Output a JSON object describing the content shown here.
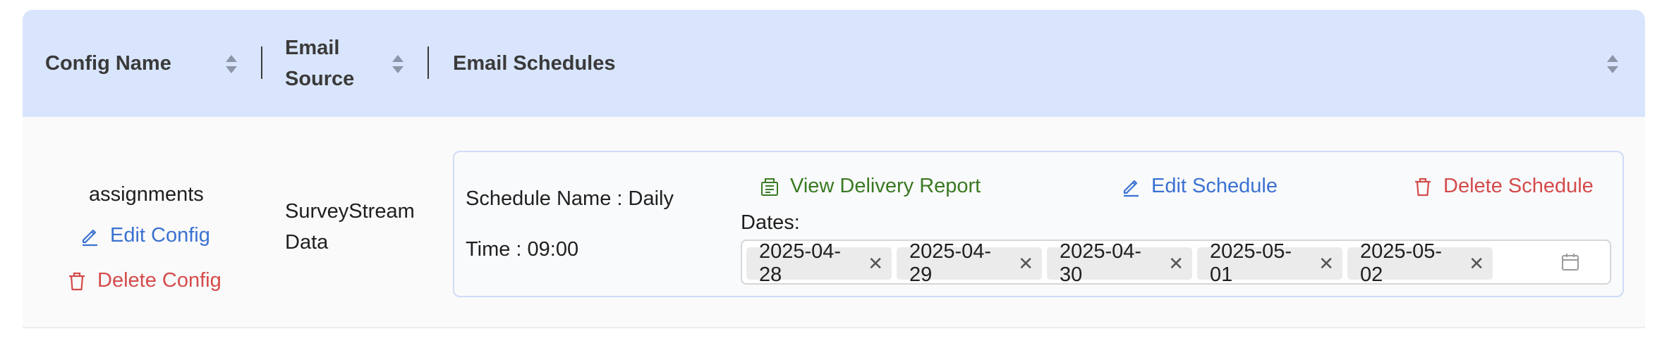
{
  "header": {
    "config_name": "Config Name",
    "email_source_line1": "Email",
    "email_source_line2": "Source",
    "email_schedules": "Email Schedules"
  },
  "row": {
    "config_name": "assignments",
    "edit_config": "Edit Config",
    "delete_config": "Delete Config",
    "email_source_line1": "SurveyStream",
    "email_source_line2": "Data",
    "schedule": {
      "name_line": "Schedule Name : Daily",
      "time_line": "Time : 09:00",
      "view_report": "View Delivery Report",
      "edit_schedule": "Edit Schedule",
      "delete_schedule": "Delete Schedule",
      "dates_label": "Dates:",
      "dates": [
        "2025-04-28",
        "2025-04-29",
        "2025-04-30",
        "2025-05-01",
        "2025-05-02"
      ]
    }
  },
  "colors": {
    "header_bg": "#d9e5fc",
    "link_blue": "#3b72d1",
    "link_red": "#d44b4b",
    "link_green": "#3a7a22"
  }
}
